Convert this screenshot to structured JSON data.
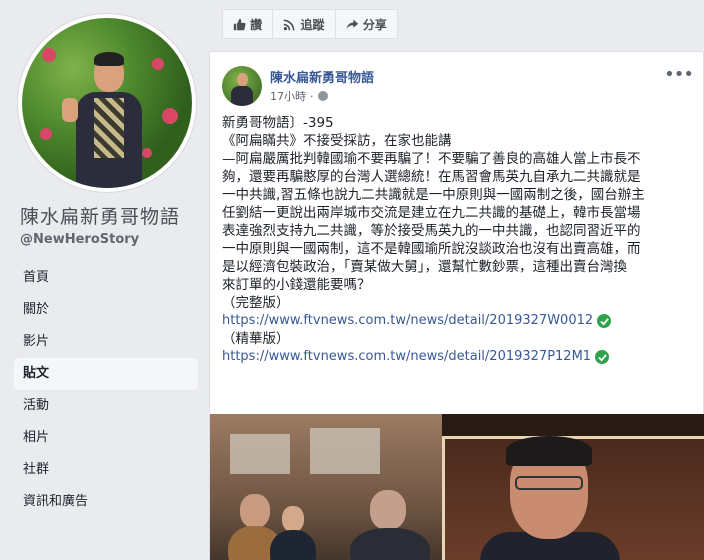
{
  "page": {
    "name": "陳水扁新勇哥物語",
    "handle": "@NewHeroStory"
  },
  "nav": {
    "items": [
      {
        "label": "首頁",
        "active": false
      },
      {
        "label": "關於",
        "active": false
      },
      {
        "label": "影片",
        "active": false
      },
      {
        "label": "貼文",
        "active": true
      },
      {
        "label": "活動",
        "active": false
      },
      {
        "label": "相片",
        "active": false
      },
      {
        "label": "社群",
        "active": false
      },
      {
        "label": "資訊和廣告",
        "active": false
      }
    ]
  },
  "actions": {
    "like": "讚",
    "follow": "追蹤",
    "share": "分享"
  },
  "post": {
    "author": "陳水扁新勇哥物語",
    "time": "17小時",
    "lines": [
      "新勇哥物語〕-395",
      "《阿扁瞞共》不接受採訪，在家也能講",
      "—阿扁嚴厲批判韓國瑜不要再騙了！不要騙了善良的高雄人當上市長不",
      "夠，還要再騙憨厚的台灣人選總統！在馬習會馬英九自承九二共識就是",
      "一中共識,習五條也說九二共識就是一中原則與一國兩制之後，國台辦主",
      "任劉結一更說出兩岸城市交流是建立在九二共識的基礎上，韓市長當場",
      "表達強烈支持九二共識，等於接受馬英九的一中共識，也認同習近平的",
      "一中原則與一國兩制，這不是韓國瑜所說沒談政治也沒有出賣高雄，而",
      "是以經濟包裝政治，「賣某做大舅」，還幫忙數鈔票，這種出賣台灣換",
      "來訂單的小錢還能要嗎？"
    ],
    "full_label": "（完整版）",
    "full_link": "https://www.ftvnews.com.tw/news/detail/2019327W0012",
    "short_label": "（精華版）",
    "short_link": "https://www.ftvnews.com.tw/news/detail/2019327P12M1"
  }
}
